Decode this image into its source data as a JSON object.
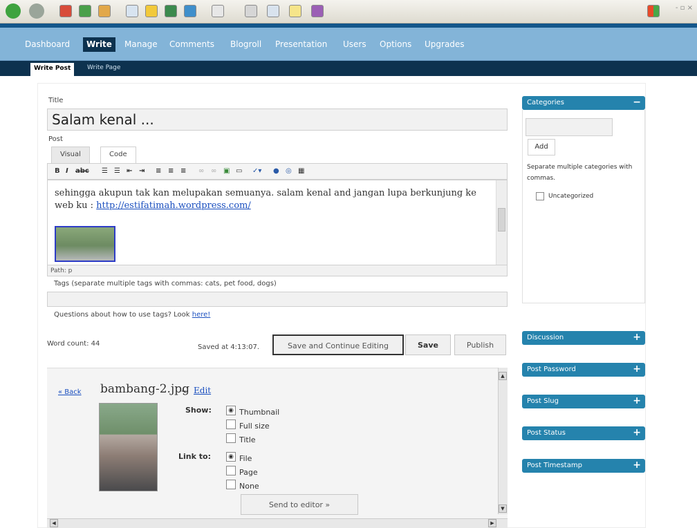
{
  "window": {
    "controls": "- ▫ ×"
  },
  "nav": {
    "items": [
      "Dashboard",
      "Write",
      "Manage",
      "Comments",
      "Blogroll",
      "Presentation",
      "Users",
      "Options",
      "Upgrades"
    ]
  },
  "subnav": {
    "items": [
      "Write Post",
      "Write Page"
    ]
  },
  "form": {
    "title_label": "Title",
    "title_value": "Salam kenal ...",
    "post_label": "Post",
    "tab_visual": "Visual",
    "tab_code": "Code",
    "editor_text": "sehingga akupun tak kan melupakan semuanya. salam kenal and jangan lupa berkunjung ke web ku : ",
    "editor_link": "http://estifatimah.wordpress.com/",
    "path": "Path: p",
    "tags_label": "Tags (separate multiple tags with commas: cats, pet food, dogs)",
    "tags_help": "Questions about how to use tags? Look ",
    "tags_help_link": "here!",
    "word_count": "Word count: 44",
    "saved_at": "Saved at 4:13:07.",
    "save_continue": "Save and Continue Editing",
    "save": "Save",
    "publish": "Publish"
  },
  "attachment": {
    "back": "« Back",
    "filename": "bambang-2.jpg",
    "dash": "–",
    "edit": "Edit",
    "show_label": "Show:",
    "show_options": [
      "Thumbnail",
      "Full size",
      "Title"
    ],
    "show_selected": 0,
    "link_label": "Link to:",
    "link_options": [
      "File",
      "Page",
      "None"
    ],
    "link_selected": 0,
    "send": "Send to editor »"
  },
  "sidebar": {
    "categories_title": "Categories",
    "add": "Add",
    "help": "Separate multiple categories with commas.",
    "uncategorized": "Uncategorized",
    "panels": [
      "Discussion",
      "Post Password",
      "Post Slug",
      "Post Status",
      "Post Timestamp"
    ]
  },
  "colors": {
    "accent": "#2583ad",
    "nav_bg": "#83b4d8",
    "subnav_bg": "#0d324f"
  }
}
